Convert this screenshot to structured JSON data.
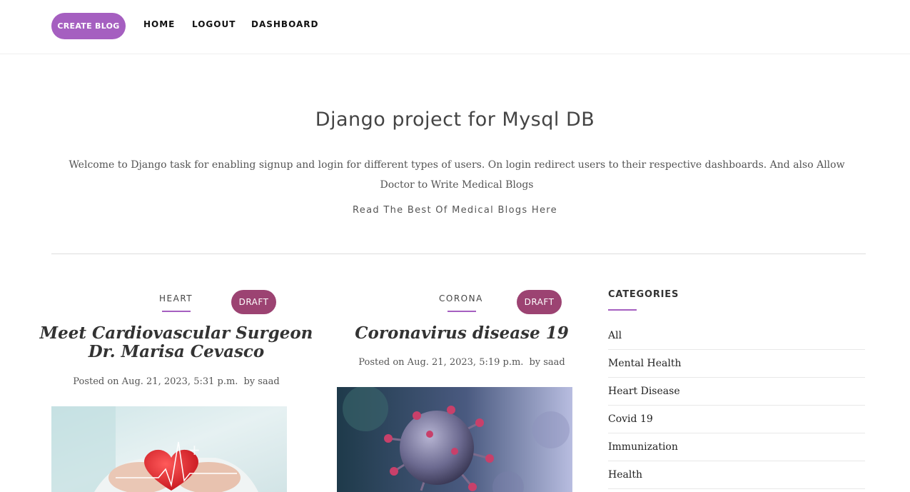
{
  "nav": {
    "create_label": "CREATE BLOG",
    "home_label": "HOME",
    "logout_label": "LOGOUT",
    "dashboard_label": "DASHBOARD"
  },
  "hero": {
    "title": "Django project for Mysql DB",
    "description": "Welcome to Django task for enabling signup and login for different types of users. On login redirect users to their respective dashboards. And also Allow Doctor to Write Medical Blogs",
    "subtitle": "Read The Best Of Medical Blogs Here"
  },
  "posts": [
    {
      "category": "HEART",
      "status": "DRAFT",
      "title": "Meet Cardiovascular Surgeon Dr. Marisa Cevasco",
      "posted": "Posted on Aug. 21, 2023, 5:31 p.m.",
      "author": "by saad"
    },
    {
      "category": "CORONA",
      "status": "DRAFT",
      "title": "Coronavirus disease 19",
      "posted": "Posted on Aug. 21, 2023, 5:19 p.m.",
      "author": "by saad"
    }
  ],
  "sidebar": {
    "title": "CATEGORIES",
    "items": [
      "All",
      "Mental Health",
      "Heart Disease",
      "Covid 19",
      "Immunization",
      "Health"
    ]
  },
  "colors": {
    "accent": "#a55fc0",
    "draft": "#9c4372"
  }
}
